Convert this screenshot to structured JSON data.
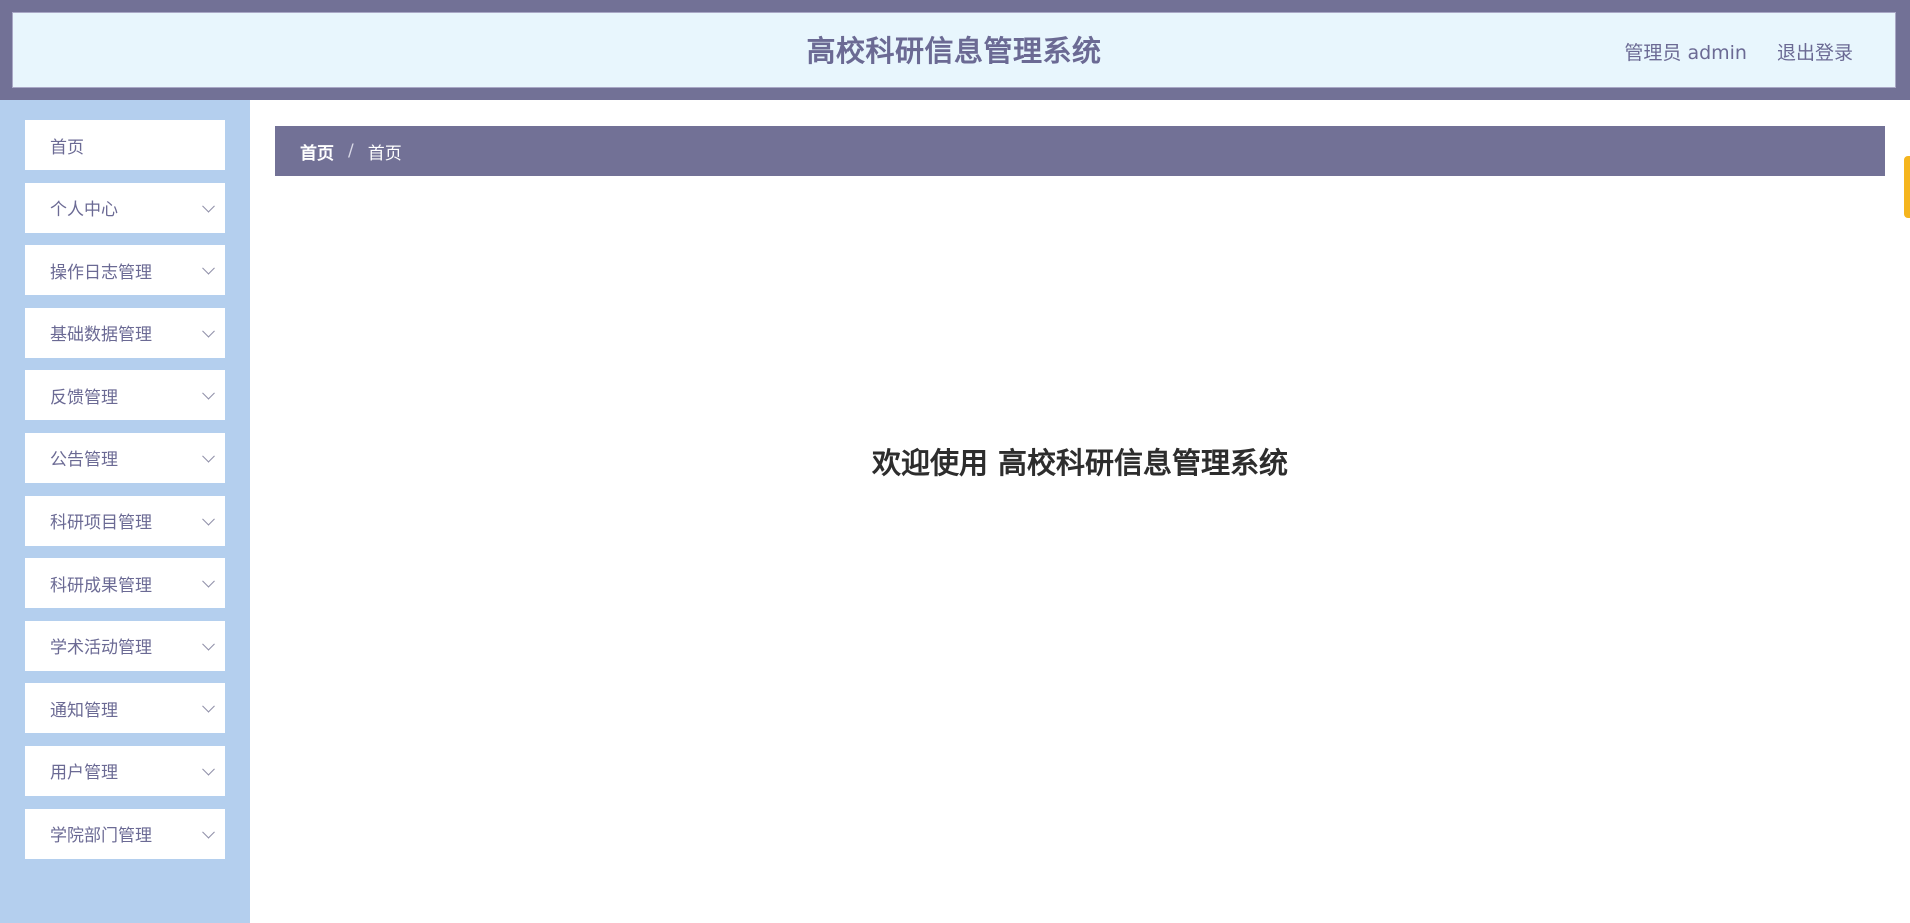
{
  "header": {
    "title": "高校科研信息管理系统",
    "user_label": "管理员 admin",
    "logout_label": "退出登录"
  },
  "sidebar": {
    "items": [
      {
        "label": "首页",
        "has_chevron": false
      },
      {
        "label": "个人中心",
        "has_chevron": true
      },
      {
        "label": "操作日志管理",
        "has_chevron": true
      },
      {
        "label": "基础数据管理",
        "has_chevron": true
      },
      {
        "label": "反馈管理",
        "has_chevron": true
      },
      {
        "label": "公告管理",
        "has_chevron": true
      },
      {
        "label": "科研项目管理",
        "has_chevron": true
      },
      {
        "label": "科研成果管理",
        "has_chevron": true
      },
      {
        "label": "学术活动管理",
        "has_chevron": true
      },
      {
        "label": "通知管理",
        "has_chevron": true
      },
      {
        "label": "用户管理",
        "has_chevron": true
      },
      {
        "label": "学院部门管理",
        "has_chevron": true
      }
    ]
  },
  "breadcrumb": {
    "first": "首页",
    "separator": "/",
    "current": "首页"
  },
  "main": {
    "welcome_text": "欢迎使用 高校科研信息管理系统"
  },
  "icons": {
    "chevron": "chevron-down-icon"
  },
  "colors": {
    "header_bg": "#727196",
    "header_inner_bg": "#e8f6fd",
    "sidebar_bg": "#b4cfee",
    "accent_text": "#6b6a94",
    "edge_tab": "#f5b51e"
  }
}
